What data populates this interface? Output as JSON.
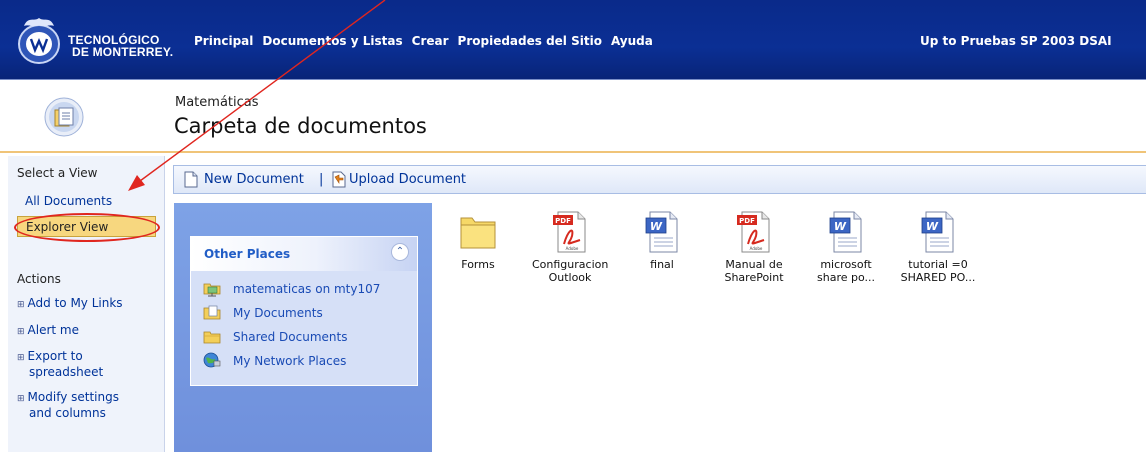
{
  "brand": {
    "line1": "TECNOLÓGICO",
    "line2": "DE MONTERREY."
  },
  "topnav": {
    "items": [
      {
        "label": "Principal"
      },
      {
        "label": "Documentos y Listas"
      },
      {
        "label": "Crear"
      },
      {
        "label": "Propiedades del Sitio"
      },
      {
        "label": "Ayuda"
      }
    ],
    "up_link": "Up to Pruebas SP 2003 DSAI"
  },
  "header": {
    "site_name": "Matemáticas",
    "library_title": "Carpeta de documentos"
  },
  "sidebar": {
    "select_view_heading": "Select a View",
    "views": [
      {
        "label": "All Documents",
        "selected": false
      },
      {
        "label": "Explorer View",
        "selected": true
      }
    ],
    "actions_heading": "Actions",
    "actions": [
      {
        "line1": "Add to My Links",
        "line2": ""
      },
      {
        "line1": "Alert me",
        "line2": ""
      },
      {
        "line1": "Export to",
        "line2": "spreadsheet"
      },
      {
        "line1": "Modify settings",
        "line2": "and columns"
      }
    ],
    "bullet": "⊞"
  },
  "toolbar": {
    "new_document": "New Document",
    "separator": "|",
    "upload_document": "Upload Document"
  },
  "other_places": {
    "title": "Other Places",
    "collapse_glyph": "⌃",
    "items": [
      {
        "label": "matematicas on mty107",
        "icon": "network-folder-icon"
      },
      {
        "label": "My Documents",
        "icon": "my-documents-icon"
      },
      {
        "label": "Shared Documents",
        "icon": "folder-icon"
      },
      {
        "label": "My Network Places",
        "icon": "network-places-icon"
      }
    ]
  },
  "files": [
    {
      "line1": "Forms",
      "line2": "",
      "icon": "folder-icon"
    },
    {
      "line1": "Configuracion",
      "line2": "Outlook",
      "icon": "pdf-icon"
    },
    {
      "line1": "final",
      "line2": "",
      "icon": "word-doc-icon"
    },
    {
      "line1": "Manual de",
      "line2": "SharePoint",
      "icon": "pdf-icon"
    },
    {
      "line1": "microsoft",
      "line2": "share po...",
      "icon": "word-doc-icon"
    },
    {
      "line1": "tutorial =0",
      "line2": "SHARED PO...",
      "icon": "word-doc-icon"
    }
  ],
  "icon_labels": {
    "pdf_badge": "PDF",
    "pdf_brand": "Adobe",
    "word_badge": "W"
  },
  "colors": {
    "banner_blue": "#0b2f94",
    "selected_view": "#f7d77f",
    "annotation_red": "#e0261f",
    "task_pane_blue": "#7ea2e6"
  }
}
